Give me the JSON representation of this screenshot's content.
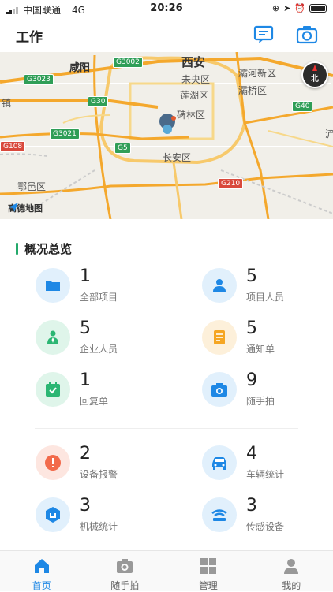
{
  "status_bar": {
    "carrier": "中国联通",
    "network": "4G",
    "time": "20:26"
  },
  "header": {
    "title": "工作",
    "message_icon": "message-icon",
    "camera_icon": "camera-icon"
  },
  "map": {
    "labels": {
      "xian": "西安",
      "xianyang": "咸阳",
      "weiyang": "未央区",
      "lianhu": "莲湖区",
      "beilin": "碑林区",
      "baqiao": "灞桥区",
      "chanba": "灞河新区",
      "changan": "长安区",
      "huyi": "鄠邑区",
      "zhen": "镇",
      "chan": "浐"
    },
    "shields": {
      "g3002": "G3002",
      "g3023": "G3023",
      "g30": "G30",
      "g3021": "G3021",
      "g5": "G5",
      "g40": "G40",
      "g108": "G108",
      "g210": "G210"
    },
    "compass": "北",
    "logo": "高德地图"
  },
  "overview": {
    "title": "概况总览",
    "items": [
      {
        "value": "1",
        "label": "全部项目",
        "icon": "folder-icon",
        "color": "#1e88e5",
        "bg": "#e1f0fc"
      },
      {
        "value": "5",
        "label": "项目人员",
        "icon": "person-icon",
        "color": "#1e88e5",
        "bg": "#e1f0fc"
      },
      {
        "value": "5",
        "label": "企业人员",
        "icon": "employee-icon",
        "color": "#2bb673",
        "bg": "#dff5ea"
      },
      {
        "value": "5",
        "label": "通知单",
        "icon": "notice-icon",
        "color": "#f5a623",
        "bg": "#fdf0da"
      },
      {
        "value": "1",
        "label": "回复单",
        "icon": "calendar-check-icon",
        "color": "#2bb673",
        "bg": "#dff5ea"
      },
      {
        "value": "9",
        "label": "随手拍",
        "icon": "camera-icon",
        "color": "#1e88e5",
        "bg": "#e1f0fc"
      },
      {
        "value": "2",
        "label": "设备报警",
        "icon": "alarm-icon",
        "color": "#f26a4b",
        "bg": "#fde6e0"
      },
      {
        "value": "4",
        "label": "车辆统计",
        "icon": "car-icon",
        "color": "#1e88e5",
        "bg": "#e1f0fc"
      },
      {
        "value": "3",
        "label": "机械统计",
        "icon": "machine-icon",
        "color": "#1e88e5",
        "bg": "#e1f0fc"
      },
      {
        "value": "3",
        "label": "传感设备",
        "icon": "sensor-icon",
        "color": "#1e88e5",
        "bg": "#e1f0fc"
      }
    ]
  },
  "tabbar": {
    "tabs": [
      {
        "label": "首页",
        "icon": "home-icon",
        "active": true
      },
      {
        "label": "随手拍",
        "icon": "camera-icon",
        "active": false
      },
      {
        "label": "管理",
        "icon": "grid-icon",
        "active": false
      },
      {
        "label": "我的",
        "icon": "user-icon",
        "active": false
      }
    ],
    "active_color": "#1e88e5"
  }
}
